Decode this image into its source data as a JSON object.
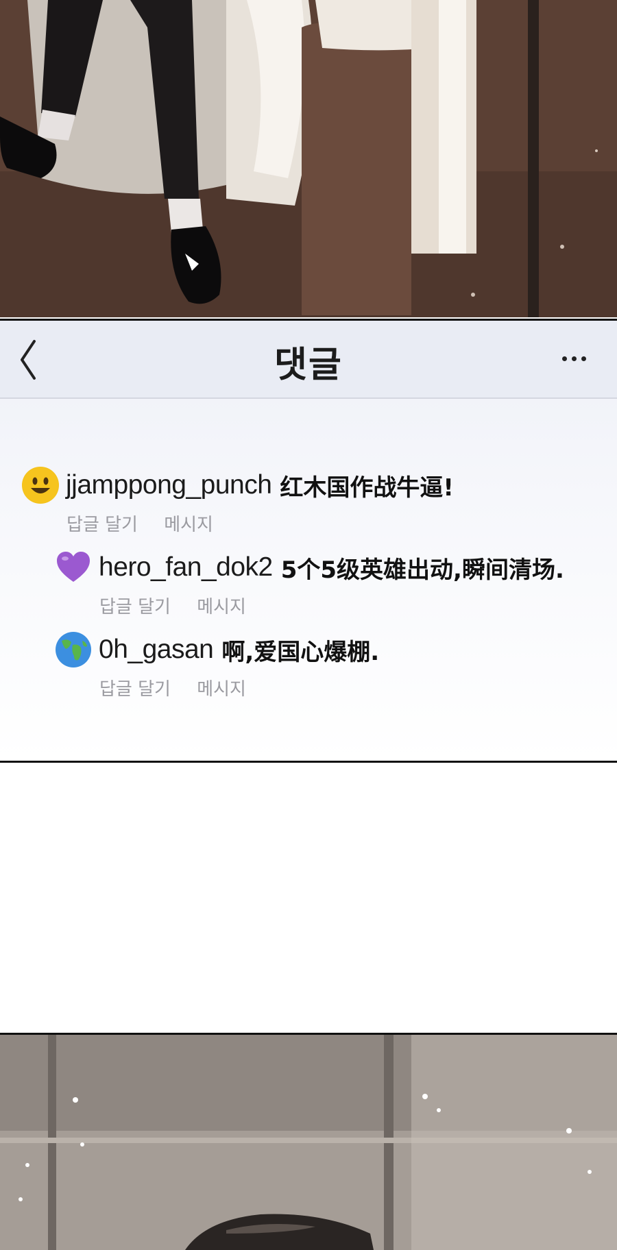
{
  "header": {
    "title": "댓글",
    "back_icon": "chevron-left-icon",
    "more_icon": "more-horizontal-icon"
  },
  "comments": [
    {
      "avatar_icon": "smiley-face-icon",
      "username": "jjamppong_punch",
      "text": "红木国作战牛逼!",
      "reply_label": "답글 달기",
      "message_label": "메시지"
    },
    {
      "avatar_icon": "purple-heart-icon",
      "username": "hero_fan_dok2",
      "text": "5个5级英雄出动,瞬间清场.",
      "reply_label": "답글 달기",
      "message_label": "메시지"
    },
    {
      "avatar_icon": "globe-icon",
      "username": "0h_gasan",
      "text": "啊,爱国心爆棚.",
      "reply_label": "답글 달기",
      "message_label": "메시지"
    }
  ]
}
